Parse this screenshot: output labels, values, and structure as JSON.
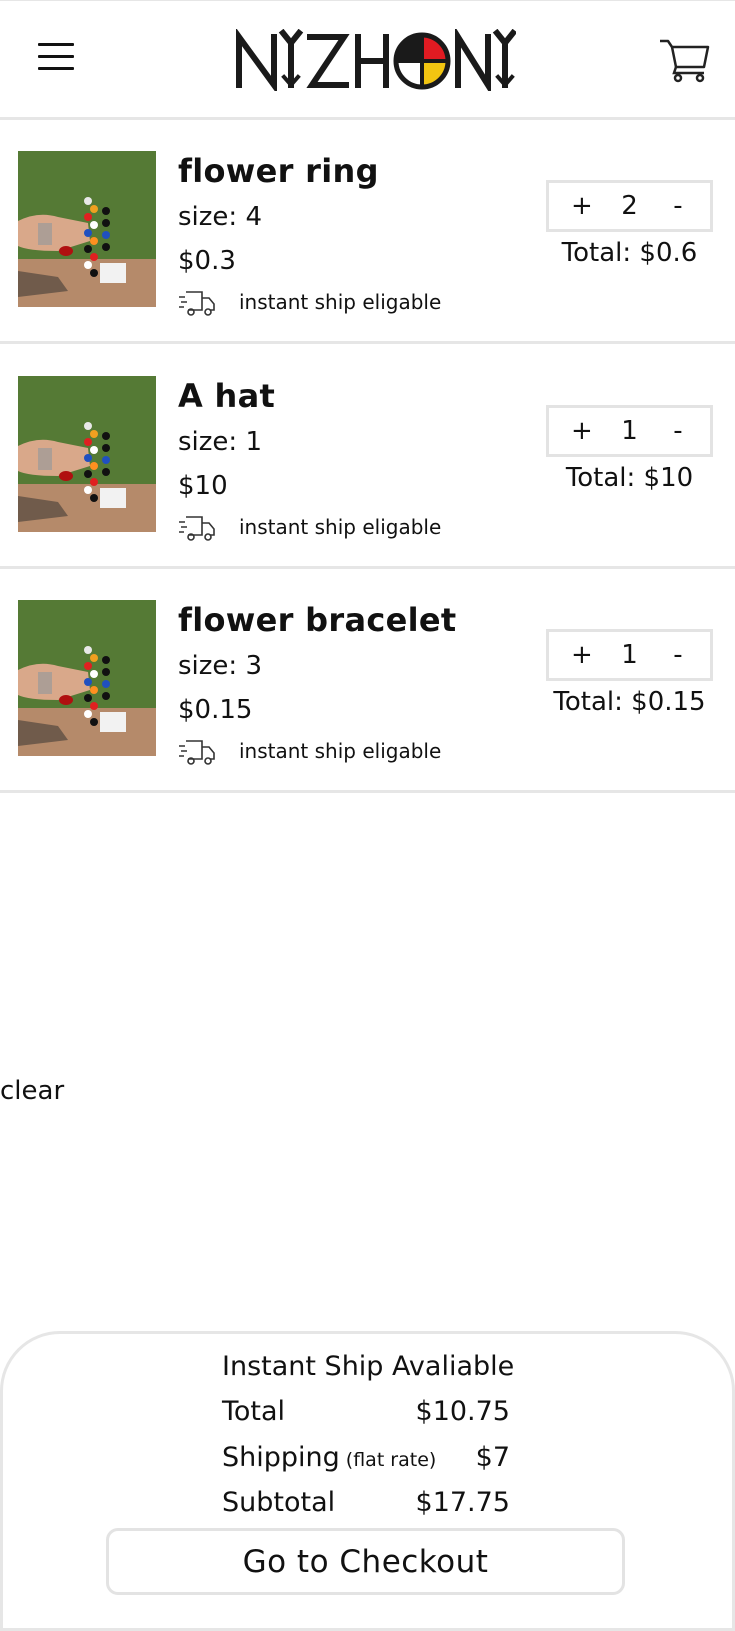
{
  "header": {
    "menu_icon": "hamburger-menu-icon",
    "logo_text": "NIZHONI",
    "cart_icon": "shopping-cart-icon"
  },
  "cart": {
    "items": [
      {
        "name": "flower ring",
        "size": "size: 4",
        "price": "$0.3",
        "ship_label": "instant ship eligable",
        "ship_icon": "delivery-truck-icon",
        "plus": "+",
        "qty": "2",
        "minus": "-",
        "total": "Total: $0.6"
      },
      {
        "name": "A hat",
        "size": "size: 1",
        "price": "$10",
        "ship_label": "instant ship eligable",
        "ship_icon": "delivery-truck-icon",
        "plus": "+",
        "qty": "1",
        "minus": "-",
        "total": "Total: $10"
      },
      {
        "name": "flower bracelet",
        "size": "size: 3",
        "price": "$0.15",
        "ship_label": "instant ship eligable",
        "ship_icon": "delivery-truck-icon",
        "plus": "+",
        "qty": "1",
        "minus": "-",
        "total": "Total: $0.15"
      }
    ],
    "clear_label": "clear"
  },
  "summary": {
    "title": "Instant Ship Avaliable",
    "total_label": "Total",
    "total_value": "$10.75",
    "shipping_label": "Shipping",
    "shipping_note": "(flat rate)",
    "shipping_value": "$7",
    "subtotal_label": "Subtotal",
    "subtotal_value": "$17.75",
    "checkout_label": "Go to Checkout"
  },
  "colors": {
    "logo_red": "#e01b22",
    "logo_yellow": "#f2c511",
    "logo_dark": "#1a1a1a",
    "border": "#e6e6e6"
  }
}
